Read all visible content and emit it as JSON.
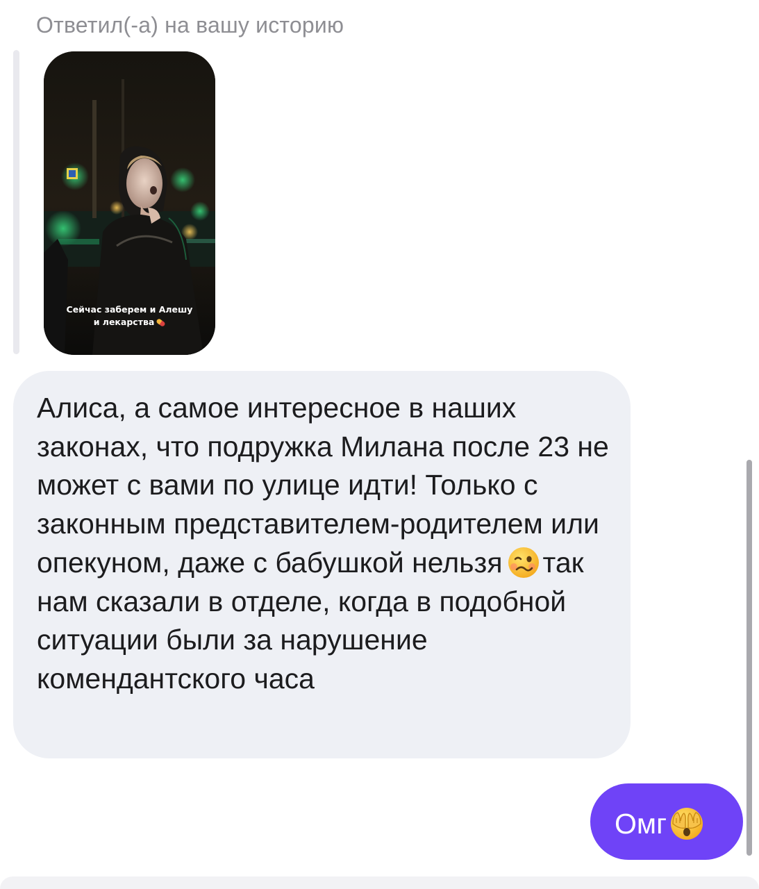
{
  "story_reply": {
    "header": "Ответил(-а) на вашу историю",
    "story_caption_line1": "Сейчас заберем и Алешу",
    "story_caption_line2": "и лекарства",
    "caption_icon": "pill-emoji"
  },
  "incoming_message": {
    "text_part1": "Алиса, а самое интересное в наших законах, что подружка Милана после 23 не может с вами по улице идти! Только с законным представителем-родителем или опекуном, даже с бабушкой нельзя",
    "emoji": "woozy-face-emoji",
    "text_part2": "так нам сказали в отделе, когда в подобной ситуации были за нарушение комендантского часа"
  },
  "outgoing_message": {
    "text": "Омг",
    "emoji": "face-with-hand-over-eyes-emoji"
  },
  "colors": {
    "incoming_bubble": "#eef0f5",
    "outgoing_bubble": "#6f43f7",
    "meta_text": "#8e8e93",
    "message_text": "#1c1c1e"
  }
}
